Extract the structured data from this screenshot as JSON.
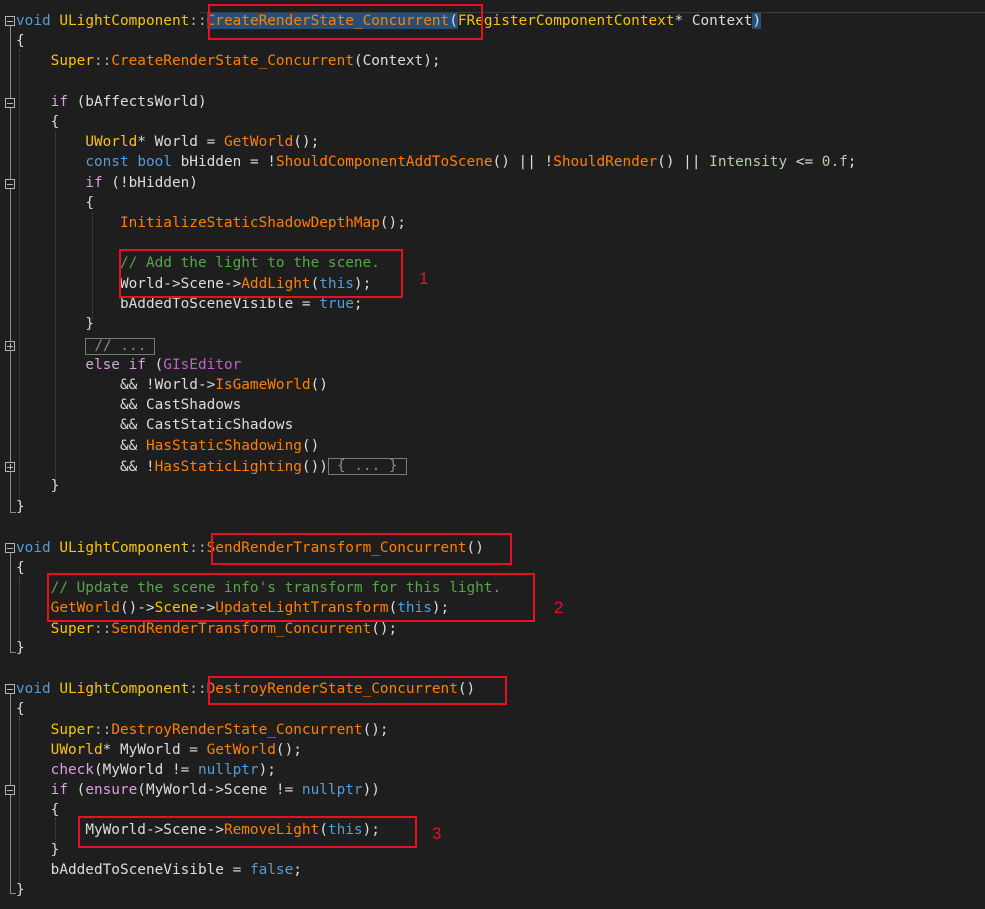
{
  "editor": {
    "markers": [
      "1",
      "2",
      "3"
    ],
    "collapsed_comment": "// ...",
    "collapsed_block": "{ ... }",
    "colors": {
      "background": "#1e1e1e",
      "keyword": "#569cd6",
      "type": "#f6c500",
      "function": "#ff8000",
      "comment": "#57a64a",
      "highlight_box": "#e81123",
      "selection": "#264f78"
    }
  },
  "code": {
    "l1": {
      "a": "void",
      "b": "ULightComponent",
      "c": "::",
      "d": "CreateRenderState_Concurrent",
      "e": "(",
      "f": "FRegisterComponentContext",
      "g": "* ",
      "h": "Context",
      "i": ")"
    },
    "l2": {
      "a": "{"
    },
    "l3": {
      "a": "Super",
      "b": "::",
      "c": "CreateRenderState_Concurrent",
      "d": "(Context);"
    },
    "l5": {
      "a": "if",
      "b": " (bAffectsWorld)"
    },
    "l6": {
      "a": "{"
    },
    "l7": {
      "a": "UWorld",
      "b": "* World = ",
      "c": "GetWorld",
      "d": "();"
    },
    "l8": {
      "a": "const",
      "b": " ",
      "c": "bool",
      "d": " bHidden = !",
      "e": "ShouldComponentAddToScene",
      "f": "() || !",
      "g": "ShouldRender",
      "h": "() || ",
      "i": "Intensity",
      "j": " <= ",
      "k": "0.f",
      "l": ";"
    },
    "l9": {
      "a": "if",
      "b": " (!bHidden)"
    },
    "l10": {
      "a": "{"
    },
    "l11": {
      "a": "InitializeStaticShadowDepthMap",
      "b": "();"
    },
    "l13": {
      "a": "// Add the light to the scene."
    },
    "l14": {
      "a": "World->Scene->",
      "b": "AddLight",
      "c": "(",
      "d": "this",
      "e": ");"
    },
    "l15": {
      "a": "bAddedToSceneVisible = ",
      "b": "true",
      "c": ";"
    },
    "l16": {
      "a": "}"
    },
    "l18": {
      "a": "else",
      "b": " ",
      "c": "if",
      "d": " (",
      "e": "GIsEditor"
    },
    "l19": {
      "a": "&& !World->",
      "b": "IsGameWorld",
      "c": "()"
    },
    "l20": {
      "a": "&& CastShadows"
    },
    "l21": {
      "a": "&& CastStaticShadows"
    },
    "l22": {
      "a": "&& ",
      "b": "HasStaticShadowing",
      "c": "()"
    },
    "l23": {
      "a": "&& !",
      "b": "HasStaticLighting",
      "c": "())"
    },
    "l24": {
      "a": "}"
    },
    "l25": {
      "a": "}"
    },
    "l27": {
      "a": "void",
      "b": "ULightComponent",
      "c": "::",
      "d": "SendRenderTransform_Concurrent",
      "e": "()"
    },
    "l28": {
      "a": "{"
    },
    "l29": {
      "a": "// Update the scene info's transform for this light."
    },
    "l30": {
      "a": "GetWorld",
      "b": "()->",
      "c": "Scene",
      "d": "->",
      "e": "UpdateLightTransform",
      "f": "(",
      "g": "this",
      "h": ");"
    },
    "l31": {
      "a": "Super",
      "b": "::",
      "c": "SendRenderTransform_Concurrent",
      "d": "();"
    },
    "l32": {
      "a": "}"
    },
    "l34": {
      "a": "void",
      "b": "ULightComponent",
      "c": "::",
      "d": "DestroyRenderState_Concurrent",
      "e": "()"
    },
    "l35": {
      "a": "{"
    },
    "l36": {
      "a": "Super",
      "b": "::",
      "c": "DestroyRenderState_Concurrent",
      "d": "();"
    },
    "l37": {
      "a": "UWorld",
      "b": "* MyWorld = ",
      "c": "GetWorld",
      "d": "();"
    },
    "l38": {
      "a": "check",
      "b": "(MyWorld != ",
      "c": "nullptr",
      "d": ");"
    },
    "l39": {
      "a": "if",
      "b": " (",
      "c": "ensure",
      "d": "(MyWorld->Scene != ",
      "e": "nullptr",
      "f": "))"
    },
    "l40": {
      "a": "{"
    },
    "l41": {
      "a": "MyWorld->Scene->",
      "b": "RemoveLight",
      "c": "(",
      "d": "this",
      "e": ");"
    },
    "l42": {
      "a": "}"
    },
    "l43": {
      "a": "bAddedToSceneVisible = ",
      "b": "false",
      "c": ";"
    },
    "l44": {
      "a": "}"
    }
  }
}
